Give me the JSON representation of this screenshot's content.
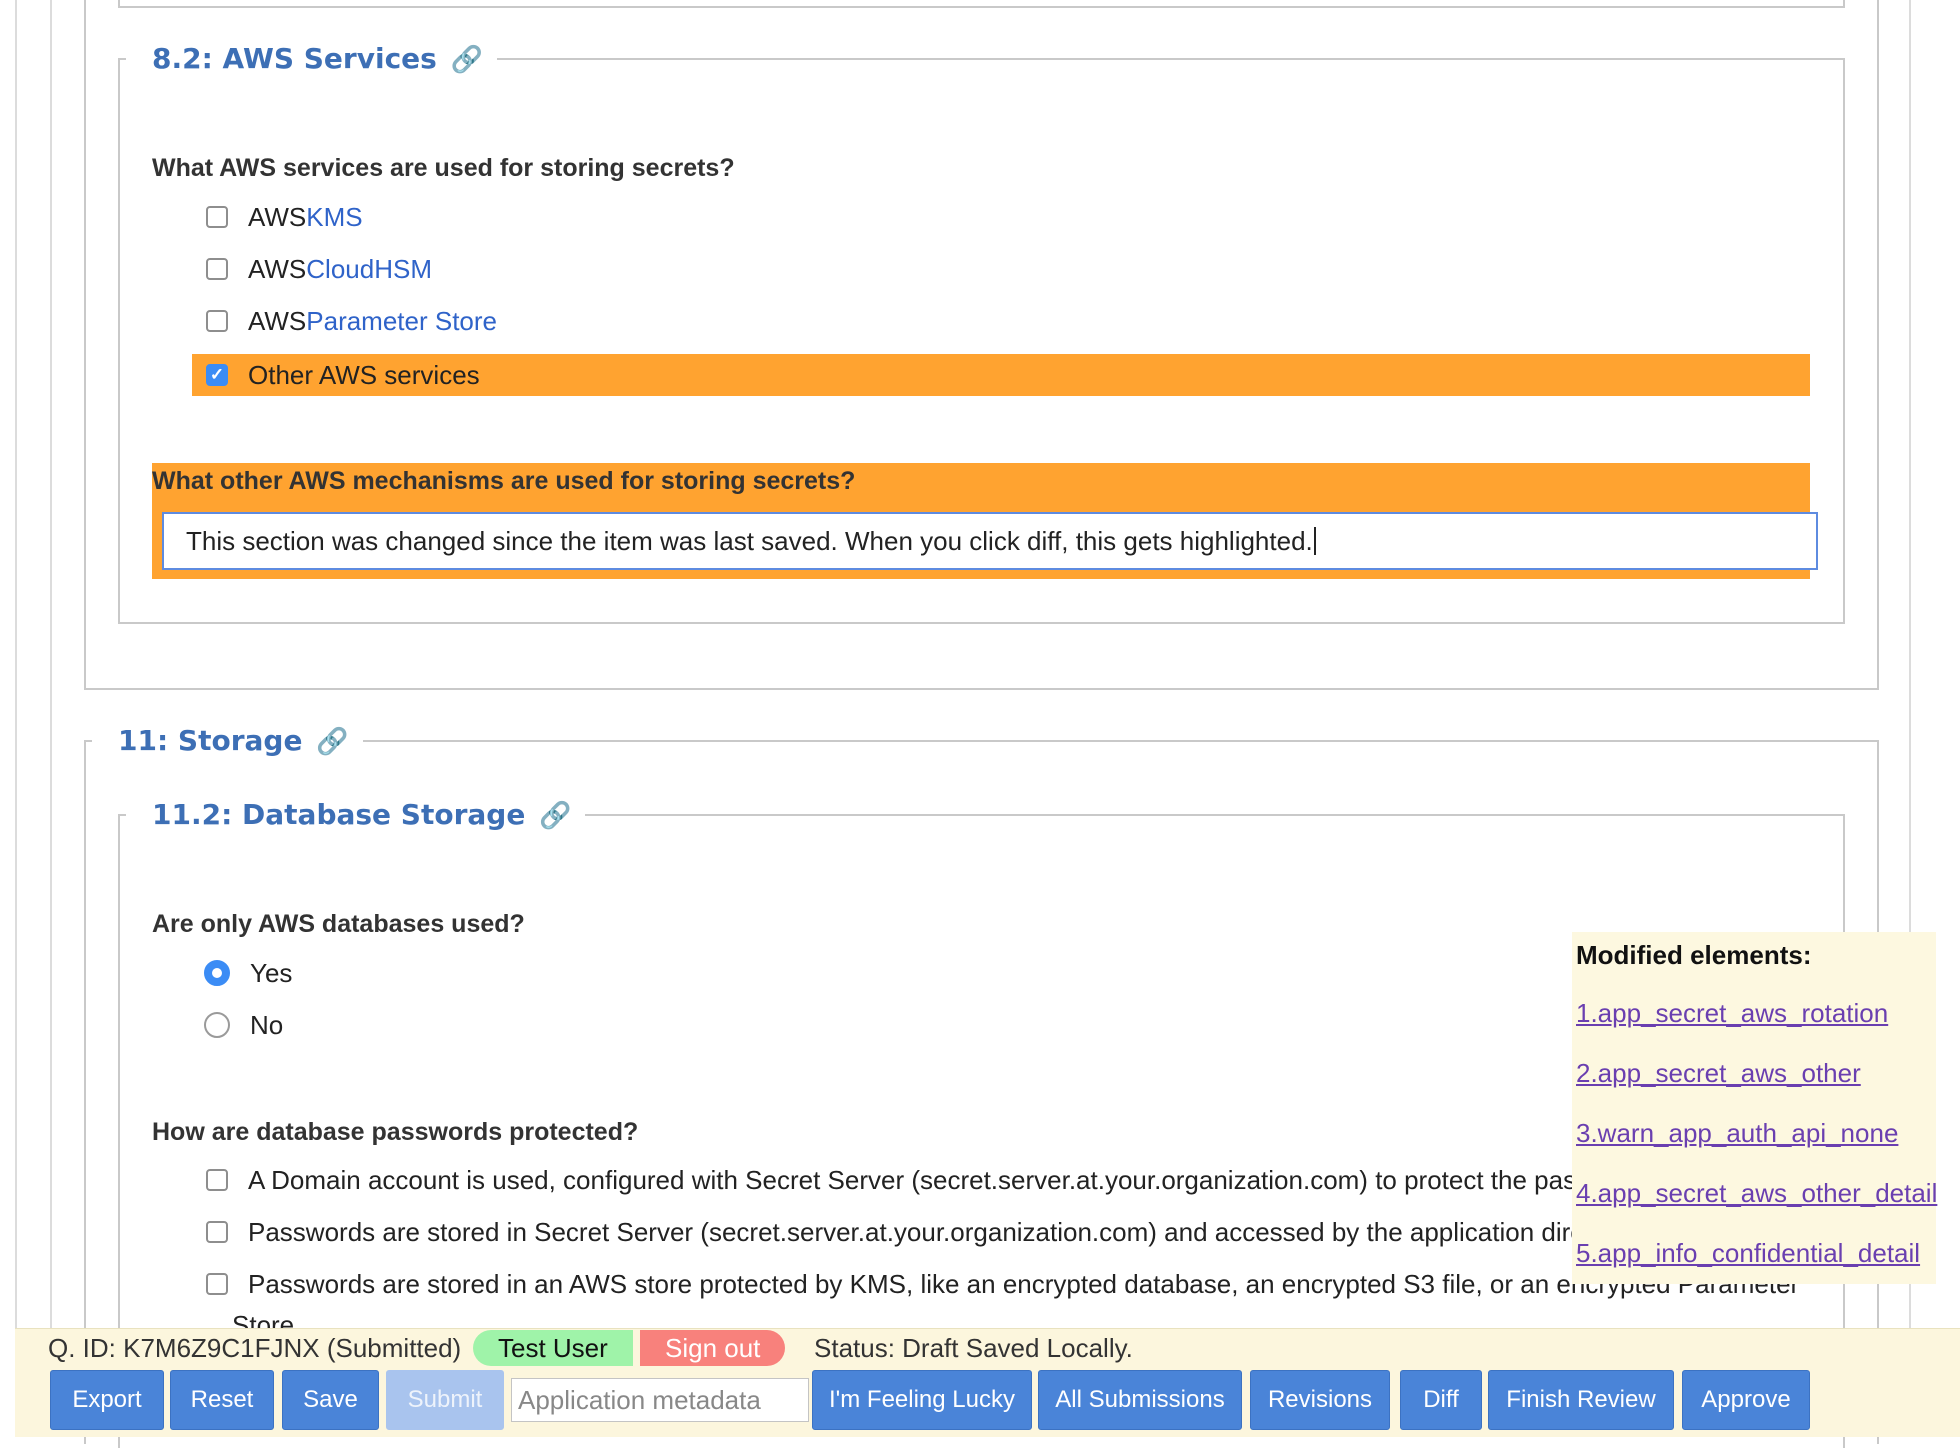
{
  "section_8_2": {
    "legend": "8.2: AWS Services",
    "link_icon": "chain-link-icon",
    "question1": "What AWS services are used for storing secrets?",
    "options": [
      {
        "prefix": "AWS ",
        "link": "KMS",
        "checked": false
      },
      {
        "prefix": "AWS ",
        "link": "CloudHSM",
        "checked": false
      },
      {
        "prefix": "AWS ",
        "link": "Parameter Store",
        "checked": false
      },
      {
        "prefix": "Other AWS services",
        "link": "",
        "checked": true
      }
    ],
    "question2": "What other AWS mechanisms are used for storing secrets?",
    "answer2": "This section was changed since the item was last saved. When you click diff, this gets highlighted."
  },
  "section_11": {
    "legend": "11: Storage",
    "link_icon": "chain-link-icon"
  },
  "section_11_2": {
    "legend": "11.2: Database Storage",
    "link_icon": "chain-link-icon",
    "question1": "Are only AWS databases used?",
    "radios": [
      {
        "label": "Yes",
        "checked": true
      },
      {
        "label": "No",
        "checked": false
      }
    ],
    "question2": "How are database passwords protected?",
    "options": [
      "A Domain account is used, configured with Secret Server (secret.server.at.your.organization.com) to protect the password",
      "Passwords are stored in Secret Server (secret.server.at.your.organization.com) and accessed by the application directly",
      "Passwords are stored in an AWS store protected by KMS, like an encrypted database, an encrypted S3 file, or an encrypted Parameter"
    ],
    "option3_cont": "Store"
  },
  "modified_panel": {
    "title": "Modified elements:",
    "items": [
      "1.app_secret_aws_rotation",
      "2.app_secret_aws_other",
      "3.warn_app_auth_api_none",
      "4.app_secret_aws_other_detail",
      "5.app_info_confidential_detail"
    ]
  },
  "footer": {
    "qid": "Q. ID: K7M6Z9C1FJNX (Submitted)",
    "user": "Test User",
    "sign_out": "Sign out",
    "status": "Status: Draft Saved Locally.",
    "metadata_placeholder": "Application metadata",
    "buttons": {
      "export": "Export",
      "reset": "Reset",
      "save": "Save",
      "submit": "Submit",
      "lucky": "I'm Feeling Lucky",
      "all_submissions": "All Submissions",
      "revisions": "Revisions",
      "diff": "Diff",
      "finish_review": "Finish Review",
      "approve": "Approve"
    }
  },
  "colors": {
    "highlight": "#ffa330",
    "legend": "#3d6fb5",
    "button": "#4a84d8",
    "footer_bg": "#fcf6dd",
    "panel_bg": "#fdf8e0"
  }
}
